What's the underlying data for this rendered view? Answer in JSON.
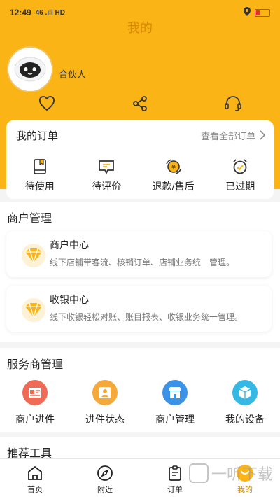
{
  "status_bar": {
    "time": "12:49",
    "network": "46 .ıll HD"
  },
  "header": {
    "title": "我的",
    "username": "合伙人"
  },
  "quick_icons": [
    "heart-icon",
    "share-icon",
    "headset-icon"
  ],
  "orders": {
    "title": "我的订单",
    "view_all": "查看全部订单",
    "items": [
      {
        "label": "待使用",
        "icon": "book-icon"
      },
      {
        "label": "待评价",
        "icon": "comment-icon"
      },
      {
        "label": "退款/售后",
        "icon": "refund-icon"
      },
      {
        "label": "已过期",
        "icon": "alarm-clock-icon"
      }
    ]
  },
  "merchant": {
    "title": "商户管理",
    "cards": [
      {
        "title": "商户中心",
        "desc": "线下店铺带客流、核销订单、店铺业务统一管理。"
      },
      {
        "title": "收银中心",
        "desc": "线下收银轻松对账、账目报表、收银业务统一管理。"
      }
    ]
  },
  "service": {
    "title": "服务商管理",
    "items": [
      {
        "label": "商户进件",
        "color": "#ef6b55"
      },
      {
        "label": "进件状态",
        "color": "#f4a93a"
      },
      {
        "label": "商户管理",
        "color": "#3a93e6"
      },
      {
        "label": "我的设备",
        "color": "#36b8e4"
      }
    ]
  },
  "tools": {
    "title": "推荐工具"
  },
  "tabbar": {
    "tabs": [
      {
        "label": "首页"
      },
      {
        "label": "附近"
      },
      {
        "label": "订单"
      },
      {
        "label": "我的"
      }
    ]
  },
  "watermark": "一听下载",
  "colors": {
    "brand": "#fbb416",
    "accent": "#d58a00"
  }
}
